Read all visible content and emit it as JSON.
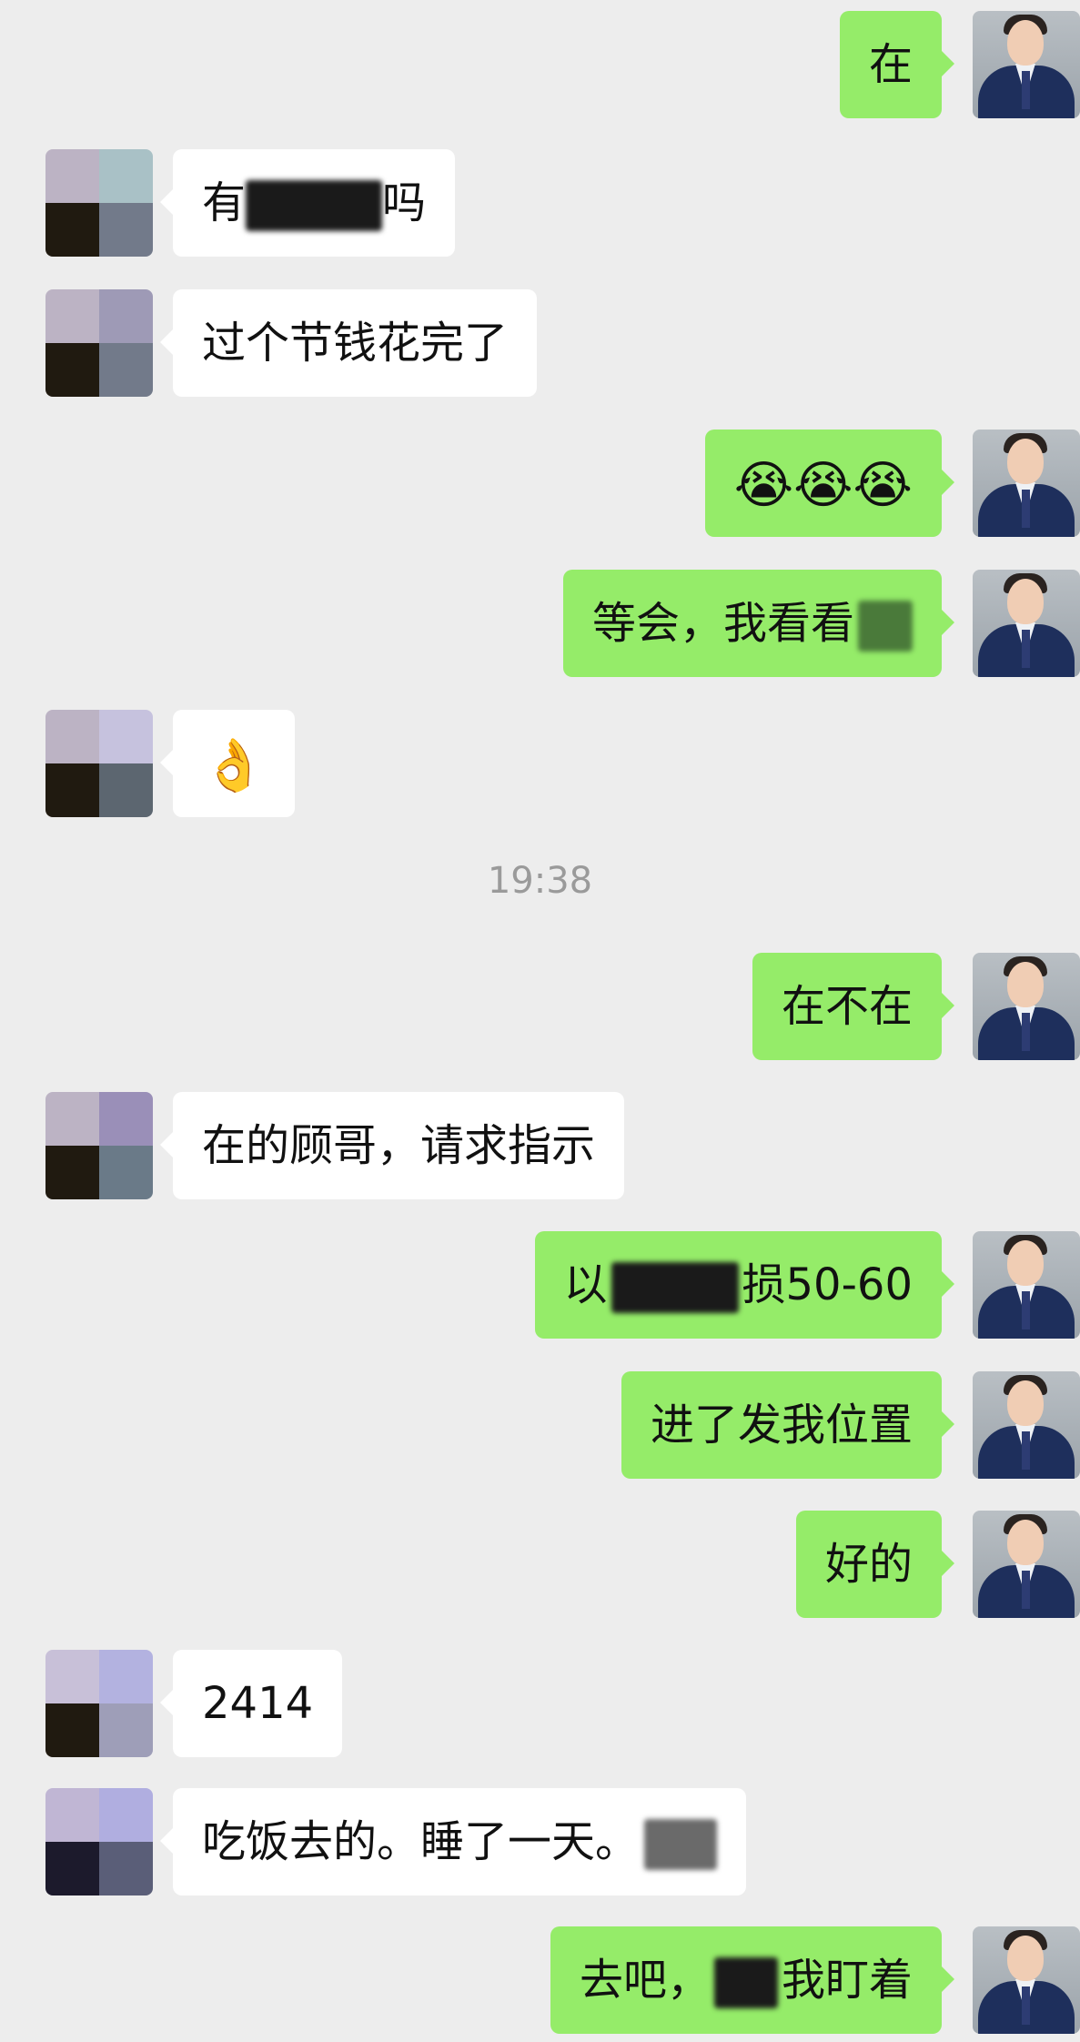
{
  "timestamp": "19:38",
  "messages": [
    {
      "side": "right",
      "text": "在"
    },
    {
      "side": "left",
      "text_before": "有",
      "text_after": "吗"
    },
    {
      "side": "left",
      "text": "过个节钱花完了"
    },
    {
      "side": "right",
      "emoji": "😭😭😭"
    },
    {
      "side": "right",
      "text": "等会，我看看"
    },
    {
      "side": "left",
      "emoji": "👌"
    },
    {
      "side": "right",
      "text": "在不在"
    },
    {
      "side": "left",
      "text": "在的顾哥，请求指示"
    },
    {
      "side": "right",
      "text_before": "以",
      "text_after": "损50-60"
    },
    {
      "side": "right",
      "text": "进了发我位置"
    },
    {
      "side": "right",
      "text": "好的"
    },
    {
      "side": "left",
      "text": "2414"
    },
    {
      "side": "left",
      "text": "吃饭去的。睡了一天。"
    },
    {
      "side": "right",
      "text_before": "去吧，",
      "text_after": "我盯着"
    }
  ],
  "avatars": {
    "self": "avatar-man-in-suit",
    "contact": "avatar-pixelated-mosaic"
  },
  "colors": {
    "background": "#ededed",
    "outgoing_bubble": "#95ec69",
    "incoming_bubble": "#ffffff",
    "timestamp": "#9a9a9a"
  }
}
